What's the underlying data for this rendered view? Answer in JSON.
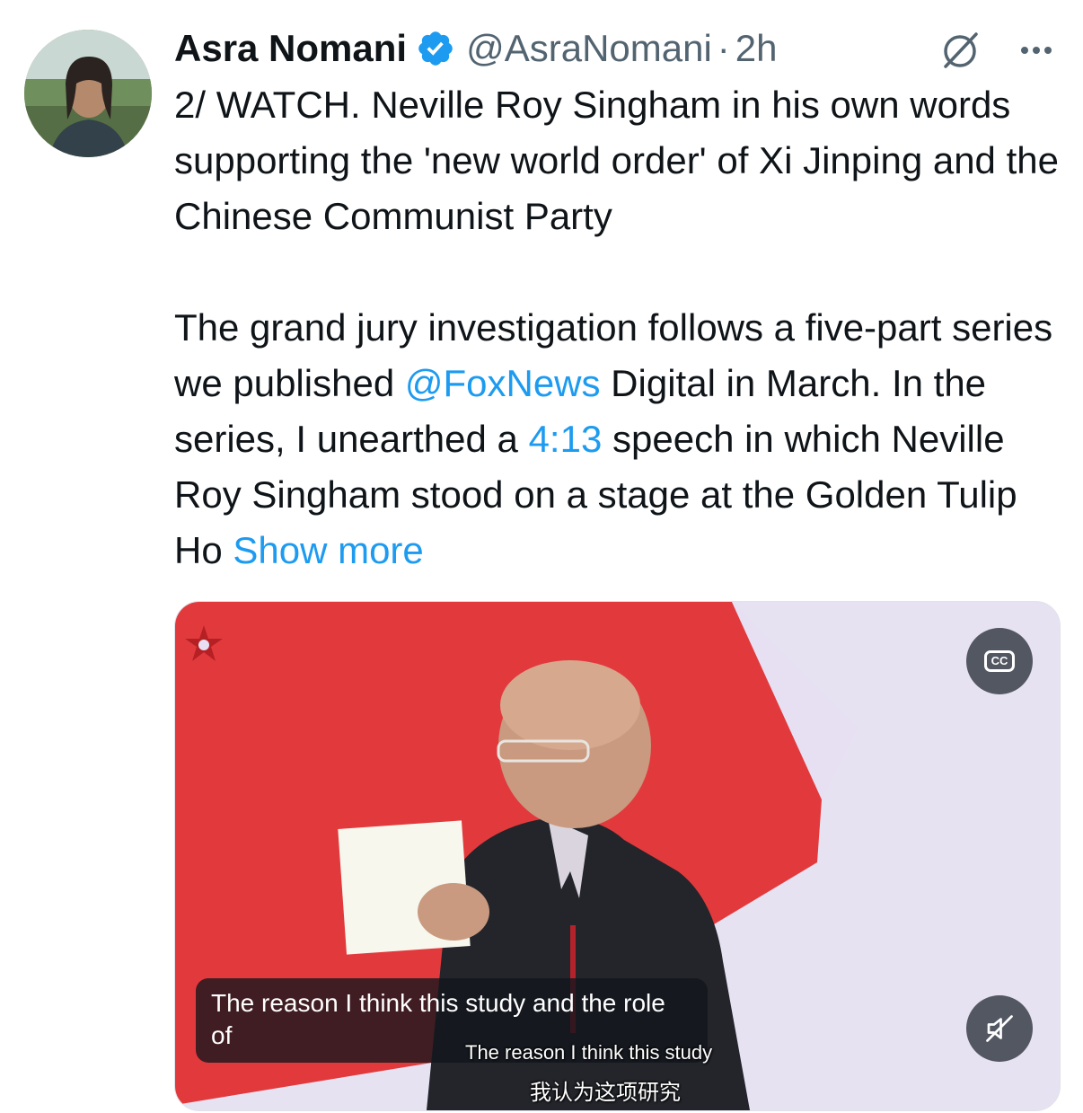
{
  "author": {
    "name": "Asra Nomani",
    "handle": "@AsraNomani",
    "separator": "·",
    "time": "2h",
    "verified_icon": "verified-badge-icon",
    "avatar_icon": "avatar"
  },
  "tweet": {
    "paragraph1": "2/ WATCH. Neville Roy Singham in his own words supporting the 'new world order' of Xi Jinping and the Chinese Communist Party",
    "p2_part1": "The grand jury investigation follows a five-part series we published ",
    "p2_link1": "@FoxNews",
    "p2_part2": " Digital in March. In the series, I unearthed a ",
    "p2_link2": "4:13",
    "p2_part3": " speech in which Neville Roy Singham stood on a stage at the Golden Tulip Ho ",
    "show_more": "Show more"
  },
  "media": {
    "caption": "The reason I think this study and the role of",
    "burned_caption_en": "The reason I think this study",
    "burned_caption_zh": "我认为这项研究",
    "cc_label": "CC",
    "mute_icon": "muted-speaker-icon"
  },
  "colors": {
    "link": "#1d9bf0",
    "text": "#0f1419",
    "secondary": "#536471"
  }
}
